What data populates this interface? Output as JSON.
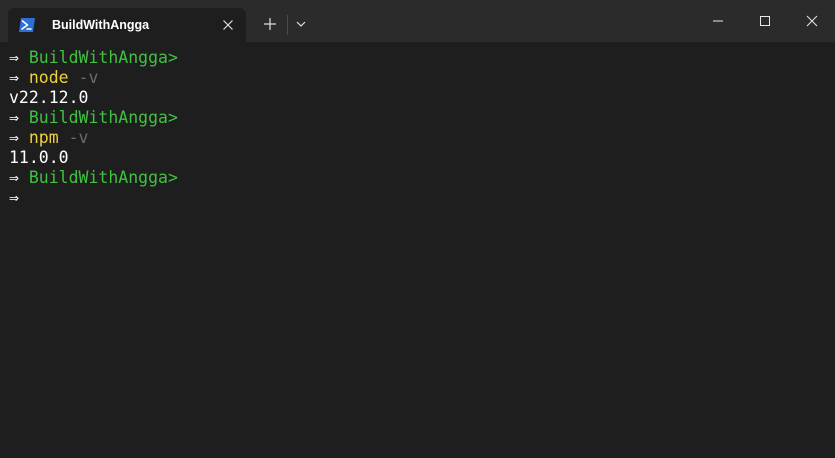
{
  "window": {
    "tab_title": "BuildWithAngga",
    "tab_icon": "powershell-icon",
    "colors": {
      "titlebar": "#2b2b2b",
      "background": "#1e1e1e",
      "prompt": "#3fc241",
      "command": "#f0d23c",
      "flag": "#6b6b6b",
      "text": "#ffffff"
    }
  },
  "terminal": {
    "arrow": "⇒",
    "lines": [
      {
        "type": "prompt",
        "text": "BuildWithAngga>"
      },
      {
        "type": "command",
        "cmd": "node",
        "flag": "-v"
      },
      {
        "type": "output",
        "text": "v22.12.0"
      },
      {
        "type": "prompt",
        "text": "BuildWithAngga>"
      },
      {
        "type": "command",
        "cmd": "npm",
        "flag": "-v"
      },
      {
        "type": "output",
        "text": "11.0.0"
      },
      {
        "type": "prompt",
        "text": "BuildWithAngga>"
      },
      {
        "type": "empty_prompt"
      }
    ]
  }
}
